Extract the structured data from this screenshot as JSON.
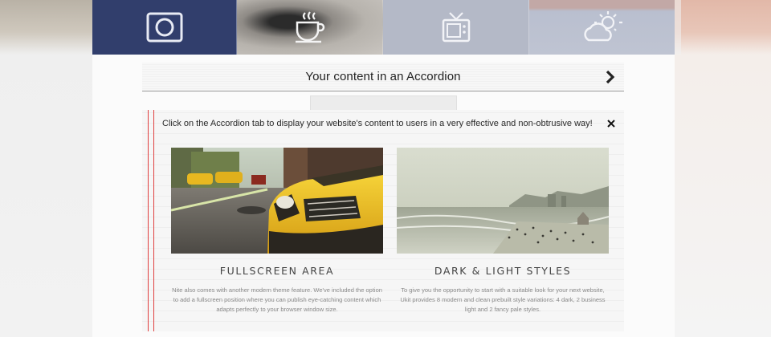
{
  "nav": {
    "items": [
      {
        "icon": "camera-icon",
        "active": true
      },
      {
        "icon": "coffee-icon",
        "active": false
      },
      {
        "icon": "tv-icon",
        "active": false
      },
      {
        "icon": "cloud-sun-icon",
        "active": false
      }
    ]
  },
  "accordion": {
    "title": "Your content in an Accordion",
    "arrow_icon": "chevron-right-icon",
    "close_icon": "close-icon",
    "intro": "Click on the Accordion tab to display your website's content to users in a very effective and non-obtrusive way!"
  },
  "columns": [
    {
      "title": "FULLSCREEN AREA",
      "text": "Nite also comes with another modern theme feature. We've included the option to add a fullscreen position where you can publish eye-catching content which adapts perfectly to your browser window size.",
      "image": "taxi-street-photo"
    },
    {
      "title": "DARK & LIGHT STYLES",
      "text": "To give you the opportunity to start with a suitable look for your next website, Ukit provides 8 modern and clean prebuilt style variations: 4 dark, 2 business light and 2 fancy pale styles.",
      "image": "beach-photo"
    }
  ],
  "colors": {
    "active_nav": "#313e6c",
    "accent_line": "#e04040"
  }
}
